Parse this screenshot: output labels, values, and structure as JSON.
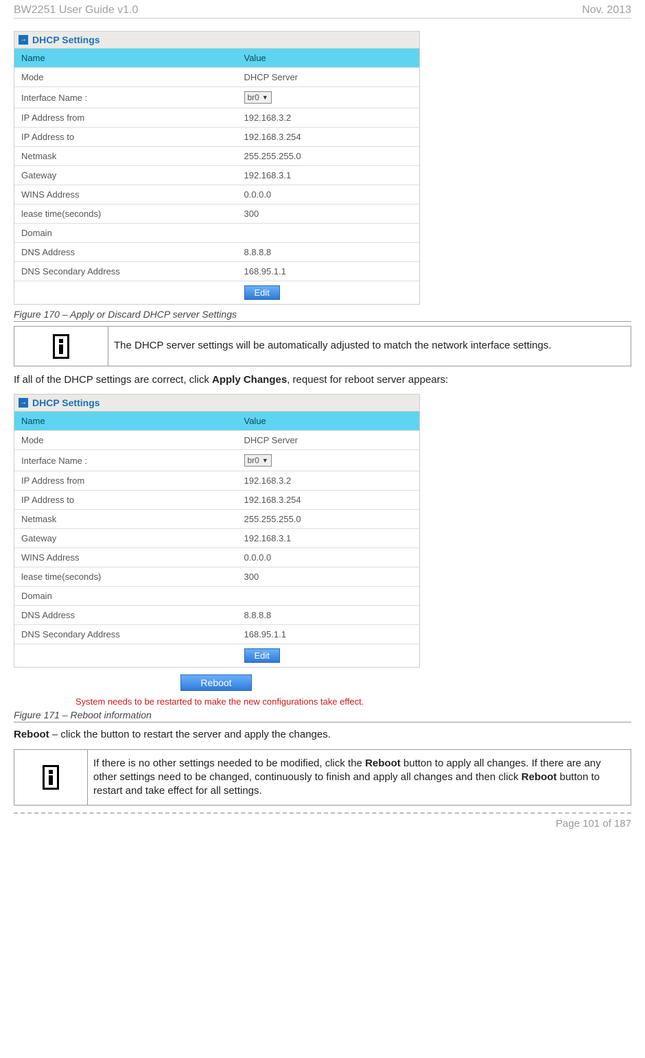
{
  "header": {
    "left": "BW2251 User Guide v1.0",
    "right": "Nov.  2013"
  },
  "panel1": {
    "title": "DHCP Settings",
    "col_name": "Name",
    "col_value": "Value",
    "rows": [
      {
        "name": "Mode",
        "value": "DHCP Server"
      },
      {
        "name": "Interface Name :",
        "select": "br0"
      },
      {
        "name": "IP Address from",
        "value": "192.168.3.2"
      },
      {
        "name": "IP Address to",
        "value": "192.168.3.254"
      },
      {
        "name": "Netmask",
        "value": "255.255.255.0"
      },
      {
        "name": "Gateway",
        "value": "192.168.3.1"
      },
      {
        "name": "WINS Address",
        "value": "0.0.0.0"
      },
      {
        "name": "lease time(seconds)",
        "value": "300"
      },
      {
        "name": "Domain",
        "value": ""
      },
      {
        "name": "DNS Address",
        "value": "8.8.8.8"
      },
      {
        "name": "DNS Secondary Address",
        "value": "168.95.1.1"
      }
    ],
    "edit": "Edit"
  },
  "caption1": "Figure 170 – Apply or Discard DHCP server Settings",
  "note1": "The DHCP server settings will be automatically adjusted to match the network interface settings.",
  "body1_pre": "If all of the DHCP settings are correct, click ",
  "body1_bold": "Apply Changes",
  "body1_post": ", request for reboot server appears:",
  "panel2": {
    "title": "DHCP Settings",
    "col_name": "Name",
    "col_value": "Value",
    "rows": [
      {
        "name": "Mode",
        "value": "DHCP Server"
      },
      {
        "name": "Interface Name :",
        "select": "br0"
      },
      {
        "name": "IP Address from",
        "value": "192.168.3.2"
      },
      {
        "name": "IP Address to",
        "value": "192.168.3.254"
      },
      {
        "name": "Netmask",
        "value": "255.255.255.0"
      },
      {
        "name": "Gateway",
        "value": "192.168.3.1"
      },
      {
        "name": "WINS Address",
        "value": "0.0.0.0"
      },
      {
        "name": "lease time(seconds)",
        "value": "300"
      },
      {
        "name": "Domain",
        "value": ""
      },
      {
        "name": "DNS Address",
        "value": "8.8.8.8"
      },
      {
        "name": "DNS Secondary Address",
        "value": "168.95.1.1"
      }
    ],
    "edit": "Edit"
  },
  "reboot_label": "Reboot",
  "reboot_msg": "System needs to be restarted to make the new configurations take effect.",
  "caption2": "Figure 171 – Reboot information",
  "body2_bold": "Reboot",
  "body2_rest": " – click the button to restart the server and apply the changes.",
  "note2_a": "If there is no other settings needed to be modified, click the ",
  "note2_b1": "Reboot",
  "note2_c": " button to apply all changes. If there are any other settings need to be changed, continuously to finish and apply all changes and then click ",
  "note2_b2": "Reboot",
  "note2_d": " button to restart and take effect  for all settings.",
  "footer": "Page 101 of 187"
}
